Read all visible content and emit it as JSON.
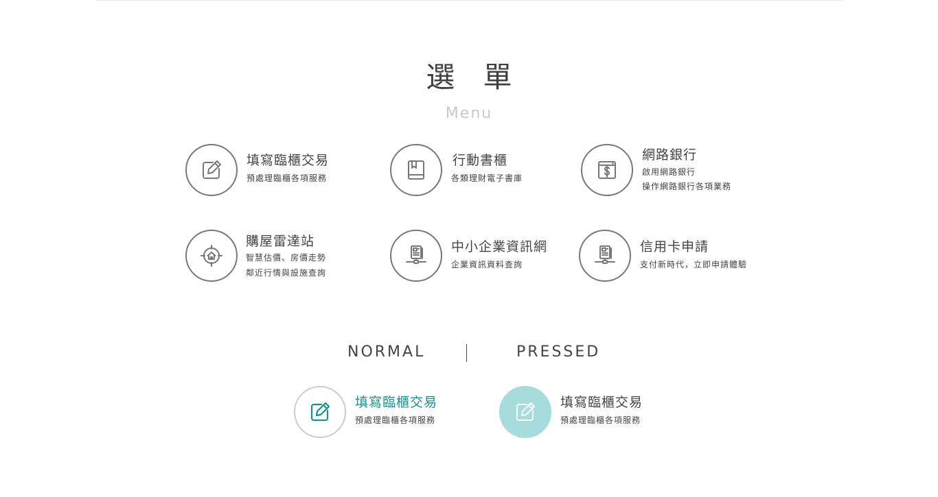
{
  "header": {
    "title": "選 單",
    "subtitle": "Menu"
  },
  "menu": {
    "items": [
      {
        "title": "填寫臨櫃交易",
        "desc_lines": [
          "預處理臨櫃各項服務"
        ],
        "icon": "pencil-edit-icon"
      },
      {
        "title": "行動書櫃",
        "desc_lines": [
          "各類理財電子書庫"
        ],
        "icon": "book-icon"
      },
      {
        "title": "網路銀行",
        "desc_lines": [
          "啟用網路銀行",
          "操作網路銀行各項業務"
        ],
        "icon": "browser-dollar-icon"
      },
      {
        "title": "購屋雷達站",
        "desc_lines": [
          "智慧估價、房價走勢",
          "鄰近行情與設施查詢"
        ],
        "icon": "house-target-icon"
      },
      {
        "title": "中小企業資訊網",
        "desc_lines": [
          "企業資訊資料查詢"
        ],
        "icon": "network-document-icon"
      },
      {
        "title": "信用卡申請",
        "desc_lines": [
          "支付新時代，立即申請體驗"
        ],
        "icon": "network-document-icon"
      }
    ]
  },
  "states": {
    "normal_label": "NORMAL",
    "pressed_label": "PRESSED",
    "normal_item": {
      "title": "填寫臨櫃交易",
      "desc": "預處理臨櫃各項服務",
      "icon": "pencil-edit-icon",
      "title_color": "#1a8f8d"
    },
    "pressed_item": {
      "title": "填寫臨櫃交易",
      "desc": "預處理臨櫃各項服務",
      "icon": "pencil-edit-icon",
      "circle_color": "#a6dcdb"
    }
  },
  "colors": {
    "icon_stroke": "#777777",
    "text": "#444444",
    "subtitle": "#c9c9c9",
    "accent_teal": "#1a8f8d",
    "pressed_fill": "#a6dcdb"
  }
}
